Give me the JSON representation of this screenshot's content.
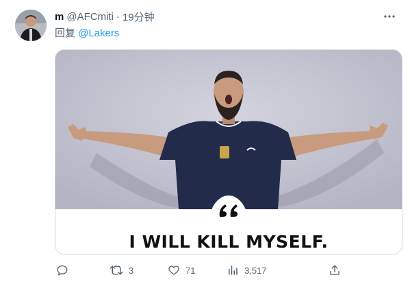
{
  "tweet": {
    "display_name": "m",
    "handle": "@AFCmiti",
    "separator": "·",
    "time": "19分钟",
    "reply_prefix": "回复",
    "reply_mention": "@Lakers",
    "media": {
      "caption": "I WILL KILL MYSELF."
    },
    "actions": {
      "reply_count": "",
      "retweet_count": "3",
      "like_count": "71",
      "views_count": "3,517"
    }
  },
  "icons": {
    "more": "more-dots-icon",
    "reply": "reply-bubble-icon",
    "retweet": "retweet-icon",
    "like": "heart-icon",
    "views": "views-chart-icon",
    "share": "share-upload-icon",
    "quote": "quote-marks-icon"
  },
  "colors": {
    "text_primary": "#0f1419",
    "text_secondary": "#536471",
    "link_blue": "#1d9bf0",
    "border": "#cfd9de"
  }
}
